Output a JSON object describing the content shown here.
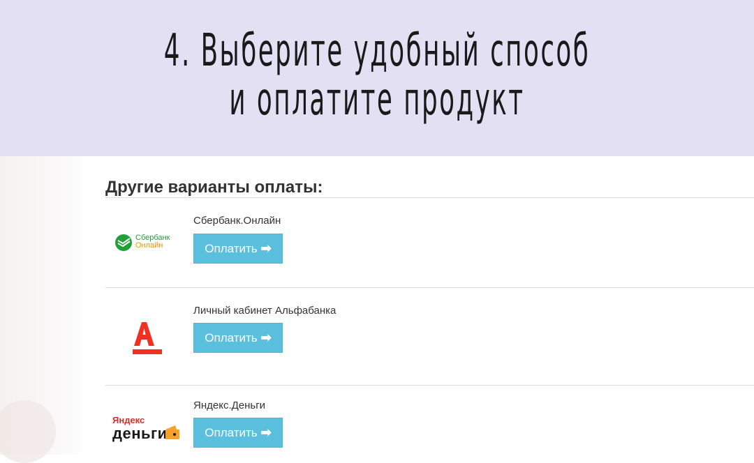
{
  "banner": {
    "line1": "4. Выберите удобный способ",
    "line2": "и оплатите продукт"
  },
  "section": {
    "title": "Другие варианты оплаты:"
  },
  "methods": [
    {
      "name": "Сбербанк.Онлайн",
      "button": "Оплатить",
      "logo": "sberbank-logo",
      "logo_text_1": "Сбербанк",
      "logo_text_2": "Онлайн"
    },
    {
      "name": "Личный кабинет Альфабанка",
      "button": "Оплатить",
      "logo": "alfabank-logo"
    },
    {
      "name": "Яндекс.Деньги",
      "button": "Оплатить",
      "logo": "yandex-money-logo",
      "logo_text_1": "Яндекс",
      "logo_text_2": "деньги"
    }
  ],
  "colors": {
    "banner_bg": "#e3e0f4",
    "button_bg": "#5bc0de",
    "alfa_red": "#ef3124",
    "sber_green": "#21a038"
  }
}
